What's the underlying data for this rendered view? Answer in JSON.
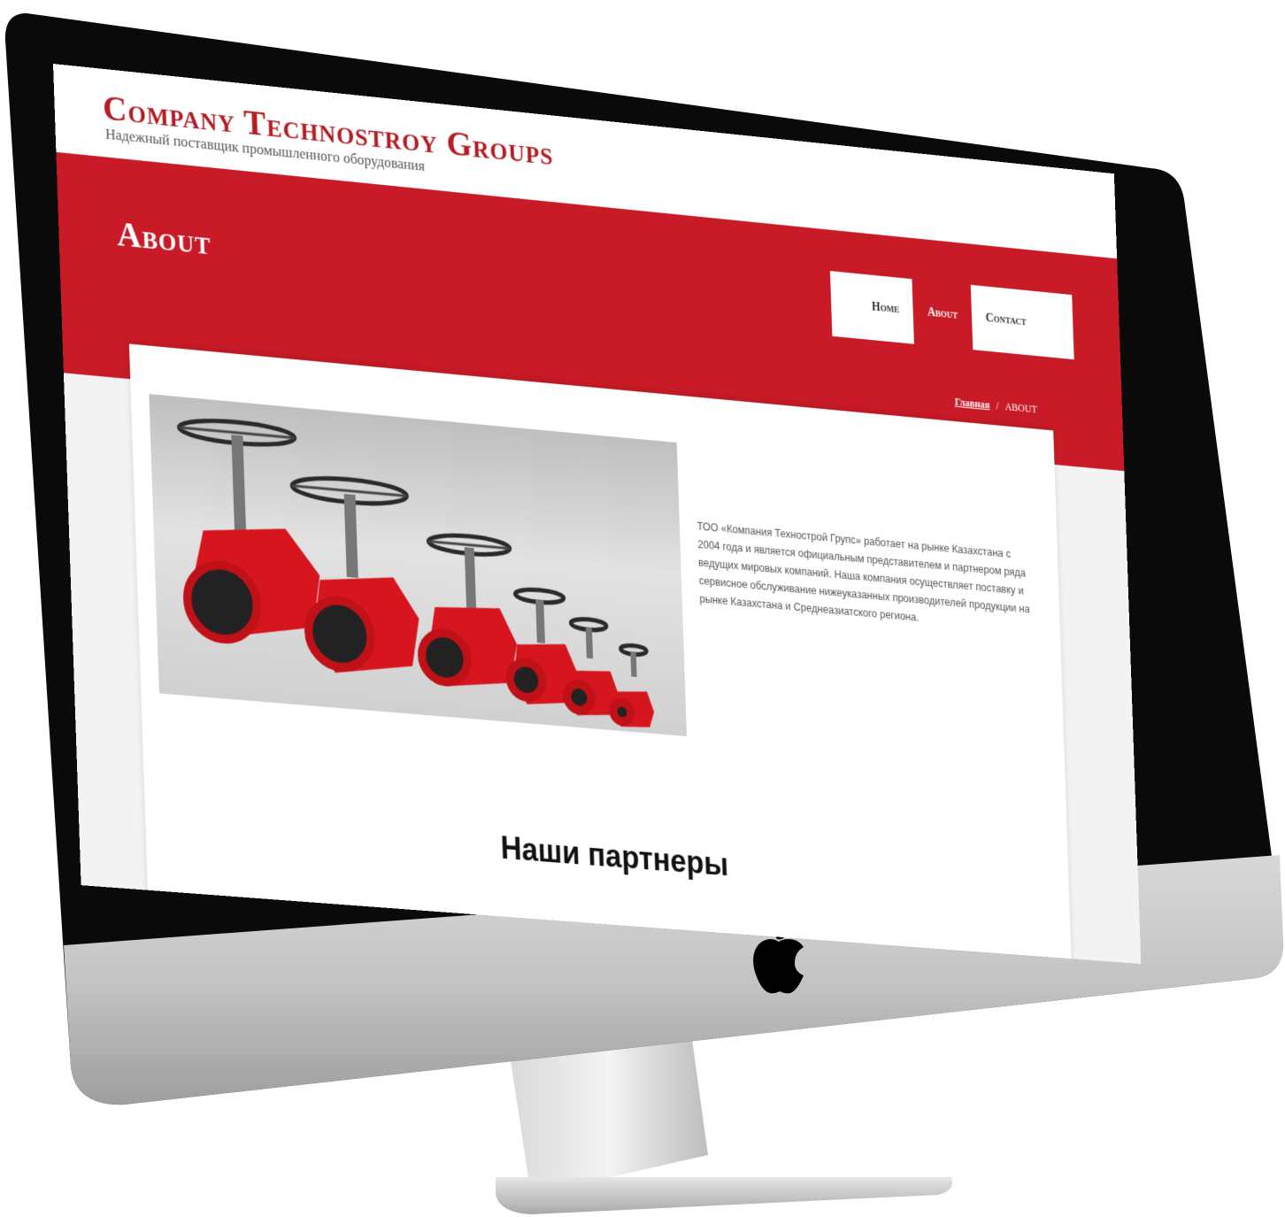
{
  "site": {
    "title": "Company Technostroy Groups",
    "tagline": "Надежный поставщик промышленного оборудования"
  },
  "hero": {
    "page_title": "About"
  },
  "nav": {
    "items": [
      {
        "label": "Home"
      },
      {
        "label": "About"
      },
      {
        "label": "Contact"
      }
    ],
    "active": "About"
  },
  "breadcrumb": {
    "home": "Главная",
    "separator": "/",
    "current": "ABOUT"
  },
  "about": {
    "text": "ТОО «Компания Технострой Групс» работает на рынке Казахстана с 2004 года и является официальным представителем и партнером ряда ведущих мировых компаний. Наша компания осуществляет поставку и сервисное обслуживание нижеуказанных производителей продукции на рынке Казахстана и Среднеазиатского региона."
  },
  "partners": {
    "heading": "Наши партнеры"
  },
  "colors": {
    "brand_red": "#c91b27",
    "title_red": "#b51d24",
    "bezel": "#000000",
    "chin": "#c9c9c9"
  },
  "icons": {
    "logo": "apple-logo-icon"
  }
}
